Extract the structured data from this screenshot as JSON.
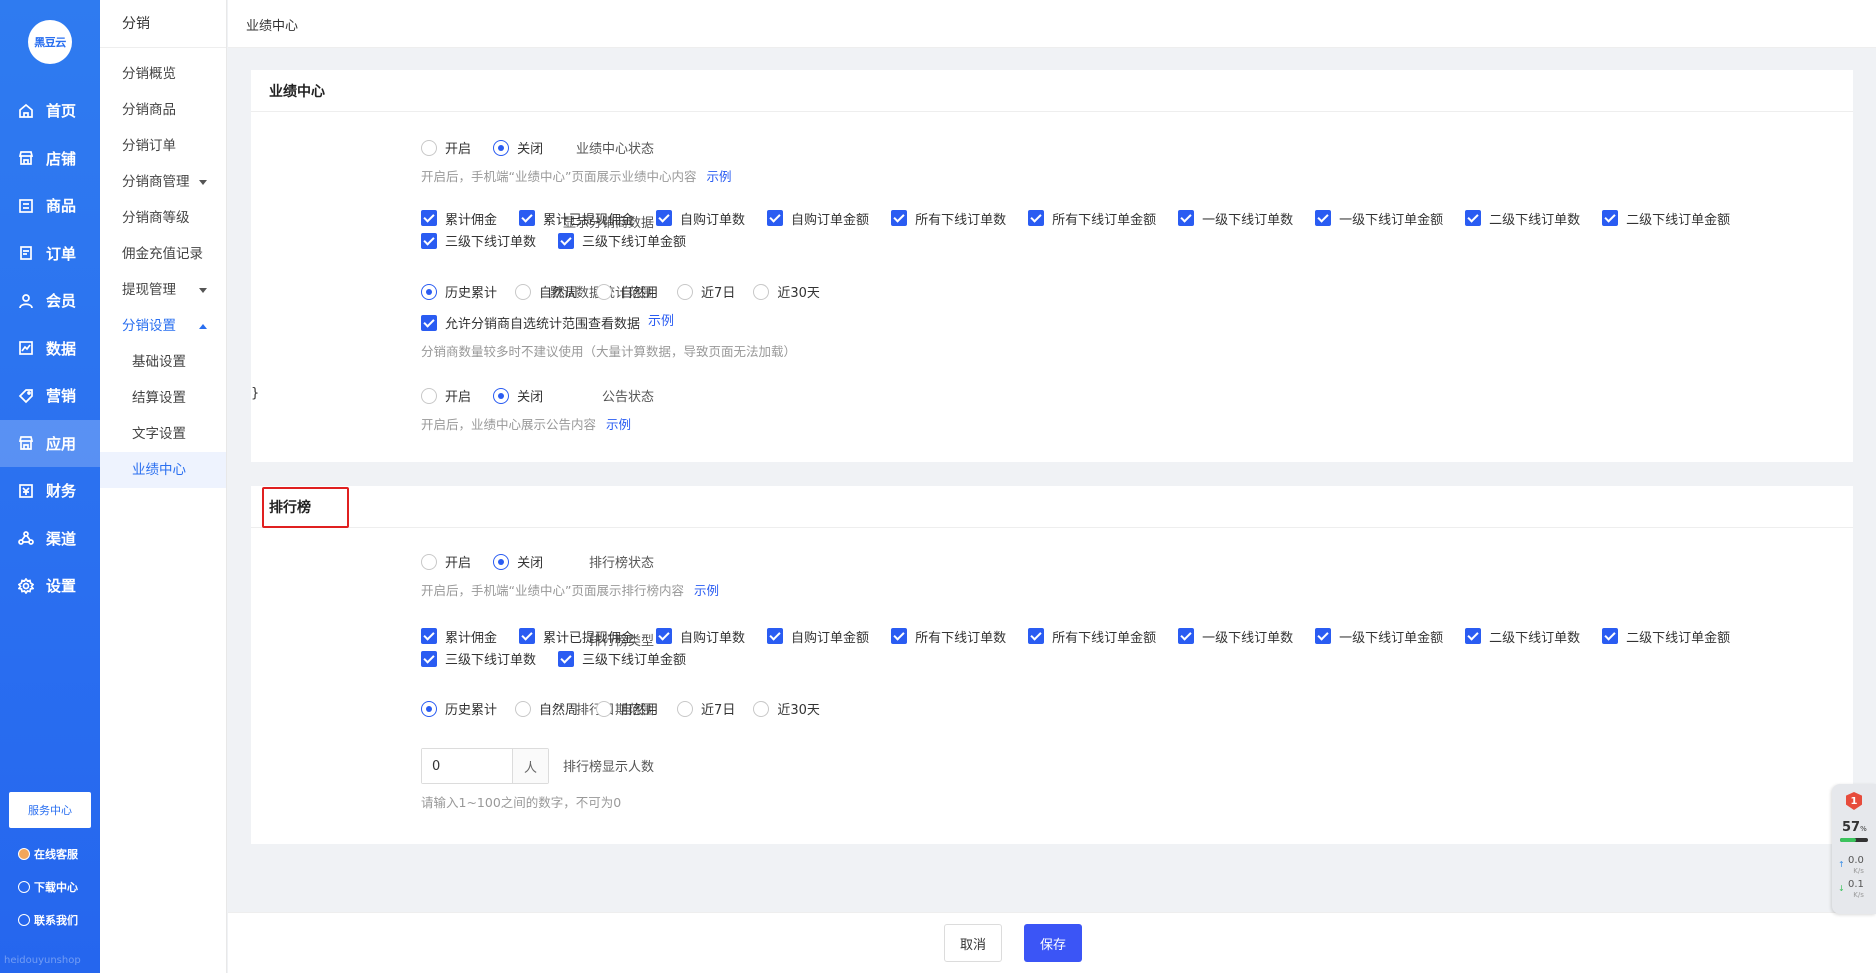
{
  "primary_nav": {
    "logo": "黑豆云",
    "items": [
      {
        "label": "首页",
        "icon": "home-icon"
      },
      {
        "label": "店铺",
        "icon": "store-icon"
      },
      {
        "label": "商品",
        "icon": "goods-icon"
      },
      {
        "label": "订单",
        "icon": "order-icon"
      },
      {
        "label": "会员",
        "icon": "member-icon"
      },
      {
        "label": "数据",
        "icon": "chart-icon"
      },
      {
        "label": "营销",
        "icon": "tag-icon"
      },
      {
        "label": "应用",
        "icon": "app-icon"
      },
      {
        "label": "财务",
        "icon": "finance-icon"
      },
      {
        "label": "渠道",
        "icon": "channel-icon"
      },
      {
        "label": "设置",
        "icon": "gear-icon"
      }
    ],
    "active_index": 7,
    "service_button": "服务中心",
    "links": [
      "在线客服",
      "下载中心",
      "联系我们"
    ],
    "watermark": "heidouyunshop"
  },
  "secondary_nav": {
    "title": "分销",
    "items": [
      {
        "label": "分销概览"
      },
      {
        "label": "分销商品"
      },
      {
        "label": "分销订单"
      },
      {
        "label": "分销商管理"
      },
      {
        "label": "分销商等级"
      },
      {
        "label": "佣金充值记录"
      },
      {
        "label": "提现管理"
      },
      {
        "label": "分销设置"
      },
      {
        "label": "基础设置"
      },
      {
        "label": "结算设置"
      },
      {
        "label": "文字设置"
      },
      {
        "label": "业绩中心"
      }
    ]
  },
  "breadcrumb": "业绩中心",
  "section1": {
    "title": "业绩中心",
    "status": {
      "label": "业绩中心状态",
      "options": [
        "开启",
        "关闭"
      ],
      "selected": "关闭",
      "hint": "开启后，手机端“业绩中心”页面展示业绩中心内容",
      "link": "示例"
    },
    "display": {
      "label": "显示分销商数据",
      "options": [
        "累计佣金",
        "累计已提现佣金",
        "自购订单数",
        "自购订单金额",
        "所有下线订单数",
        "所有下线订单金额",
        "一级下线订单数",
        "一级下线订单金额",
        "二级下线订单数",
        "二级下线订单金额",
        "三级下线订单数",
        "三级下线订单金额"
      ]
    },
    "range": {
      "label": "默认数据统计范围",
      "options": [
        "历史累计",
        "自然周",
        "自然月",
        "近7日",
        "近30天"
      ],
      "selected": "历史累计",
      "allow_label": "允许分销商自选统计范围查看数据",
      "allow_link": "示例",
      "hint": "分销商数量较多时不建议使用（大量计算数据，导致页面无法加载）"
    },
    "notice": {
      "label": "公告状态",
      "options": [
        "开启",
        "关闭"
      ],
      "selected": "关闭",
      "hint": "开启后，业绩中心展示公告内容",
      "link": "示例"
    }
  },
  "section2": {
    "title": "排行榜",
    "status": {
      "label": "排行榜状态",
      "options": [
        "开启",
        "关闭"
      ],
      "selected": "关闭",
      "hint": "开启后，手机端“业绩中心”页面展示排行榜内容",
      "link": "示例"
    },
    "type": {
      "label": "排行榜类型",
      "options": [
        "累计佣金",
        "累计已提现佣金",
        "自购订单数",
        "自购订单金额",
        "所有下线订单数",
        "所有下线订单金额",
        "一级下线订单数",
        "一级下线订单金额",
        "二级下线订单数",
        "二级下线订单金额",
        "三级下线订单数",
        "三级下线订单金额"
      ]
    },
    "date_range": {
      "label": "排行日期范围",
      "options": [
        "历史累计",
        "自然周",
        "自然月",
        "近7日",
        "近30天"
      ],
      "selected": "历史累计"
    },
    "count": {
      "label": "排行榜显示人数",
      "value": "0",
      "unit": "人",
      "hint": "请输入1~100之间的数字，不可为0"
    }
  },
  "footer": {
    "cancel": "取消",
    "save": "保存"
  },
  "widget": {
    "badge": "1",
    "percent": "57",
    "percent_unit": "%",
    "memory_usage": 0.57,
    "up": "0.0",
    "down": "0.1",
    "speed_unit": "K/s"
  }
}
